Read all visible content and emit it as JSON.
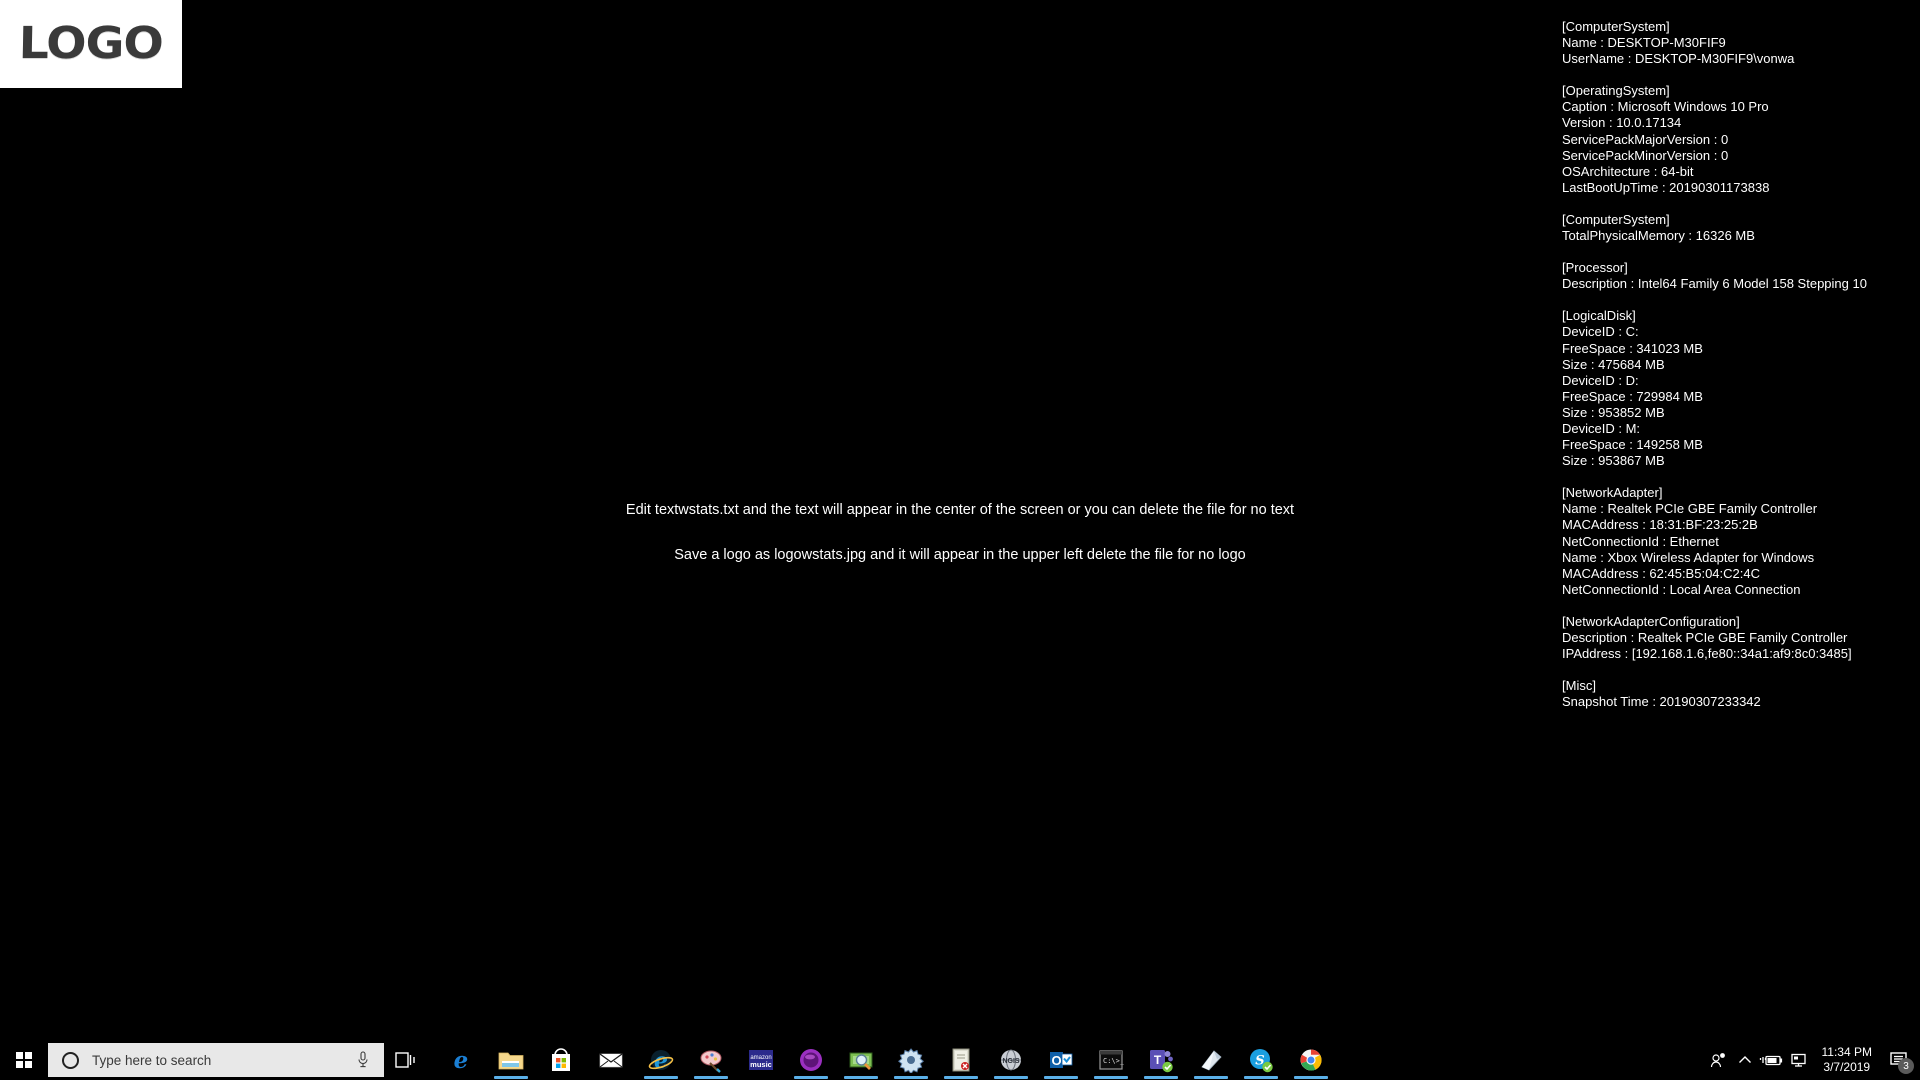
{
  "logo": {
    "text": "LOGO",
    "name": "logowstats.jpg"
  },
  "center": {
    "line1": "Edit textwstats.txt and the text will appear in the center of the screen or you can delete the file for no text",
    "line2": "Save a logo as logowstats.jpg and it will appear in the upper left delete the file for no logo"
  },
  "info_panel": {
    "sections": [
      {
        "header": "[ComputerSystem]",
        "rows": [
          "Name : DESKTOP-M30FIF9",
          "UserName : DESKTOP-M30FIF9\\vonwa"
        ]
      },
      {
        "header": "[OperatingSystem]",
        "rows": [
          "Caption : Microsoft Windows 10 Pro",
          "Version : 10.0.17134",
          "ServicePackMajorVersion : 0",
          "ServicePackMinorVersion : 0",
          "OSArchitecture : 64-bit",
          "LastBootUpTime : 20190301173838"
        ]
      },
      {
        "header": "[ComputerSystem]",
        "rows": [
          "TotalPhysicalMemory : 16326 MB"
        ]
      },
      {
        "header": "[Processor]",
        "rows": [
          "Description : Intel64 Family 6 Model 158 Stepping 10"
        ]
      },
      {
        "header": "[LogicalDisk]",
        "rows": [
          "DeviceID : C:",
          "FreeSpace : 341023 MB",
          "Size : 475684 MB",
          "DeviceID : D:",
          "FreeSpace : 729984 MB",
          "Size : 953852 MB",
          "DeviceID : M:",
          "FreeSpace : 149258 MB",
          "Size : 953867 MB"
        ]
      },
      {
        "header": "[NetworkAdapter]",
        "rows": [
          "Name : Realtek PCIe GBE Family Controller",
          "MACAddress : 18:31:BF:23:25:2B",
          "NetConnectionId : Ethernet",
          "Name : Xbox Wireless Adapter for Windows",
          "MACAddress : 62:45:B5:04:C2:4C",
          "NetConnectionId : Local Area Connection"
        ]
      },
      {
        "header": "[NetworkAdapterConfiguration]",
        "rows": [
          "Description : Realtek PCIe GBE Family Controller",
          "IPAddress : [192.168.1.6,fe80::34a1:af9:8c0:3485]"
        ]
      },
      {
        "header": "[Misc]",
        "rows": [
          "Snapshot Time : 20190307233342"
        ]
      }
    ]
  },
  "taskbar": {
    "start_label": "Start",
    "search": {
      "placeholder": "Type here to search",
      "value": "",
      "icon": "cortana-circle-icon",
      "mic_icon": "microphone-icon"
    },
    "task_view_label": "Task View",
    "apps": [
      {
        "name": "microsoft-edge",
        "label": "Microsoft Edge",
        "running": false
      },
      {
        "name": "file-explorer",
        "label": "File Explorer",
        "running": true
      },
      {
        "name": "microsoft-store",
        "label": "Microsoft Store",
        "running": false
      },
      {
        "name": "mail",
        "label": "Mail",
        "running": false
      },
      {
        "name": "internet-explorer",
        "label": "Internet Explorer",
        "running": true
      },
      {
        "name": "paint",
        "label": "Paint",
        "running": true
      },
      {
        "name": "amazon-music",
        "label": "Amazon Music",
        "running": false
      },
      {
        "name": "purple-orb-app",
        "label": "Purple Orb App",
        "running": true
      },
      {
        "name": "money-search-app",
        "label": "Money Search App",
        "running": true
      },
      {
        "name": "settings-gear-app",
        "label": "Settings",
        "running": true
      },
      {
        "name": "manual-book-app",
        "label": "Manual",
        "running": true
      },
      {
        "name": "globe-app",
        "label": "NGIS",
        "running": true
      },
      {
        "name": "outlook",
        "label": "Microsoft Outlook",
        "running": true
      },
      {
        "name": "command-prompt",
        "label": "Command Prompt",
        "running": true
      },
      {
        "name": "microsoft-teams",
        "label": "Microsoft Teams",
        "running": true
      },
      {
        "name": "onenote",
        "label": "OneNote",
        "running": true
      },
      {
        "name": "skype",
        "label": "Skype",
        "running": true
      },
      {
        "name": "google-chrome",
        "label": "Google Chrome",
        "running": true
      }
    ],
    "tray": {
      "icons": [
        {
          "name": "people-icon",
          "label": "People"
        },
        {
          "name": "show-hidden-icons",
          "label": "Show hidden icons"
        },
        {
          "name": "battery-icon",
          "label": "Battery charging"
        },
        {
          "name": "network-icon",
          "label": "Network"
        }
      ],
      "time": "11:34 PM",
      "date": "3/7/2019",
      "notification_icon": "action-center-icon",
      "notification_count": "3"
    }
  },
  "colors": {
    "desktop_background": "#000000",
    "text": "#ffffff",
    "taskbar": "#000000",
    "search_box": "#e8e8e8",
    "running_indicator": "#5bb0e8",
    "logo_fill": "#3a3a3a"
  }
}
